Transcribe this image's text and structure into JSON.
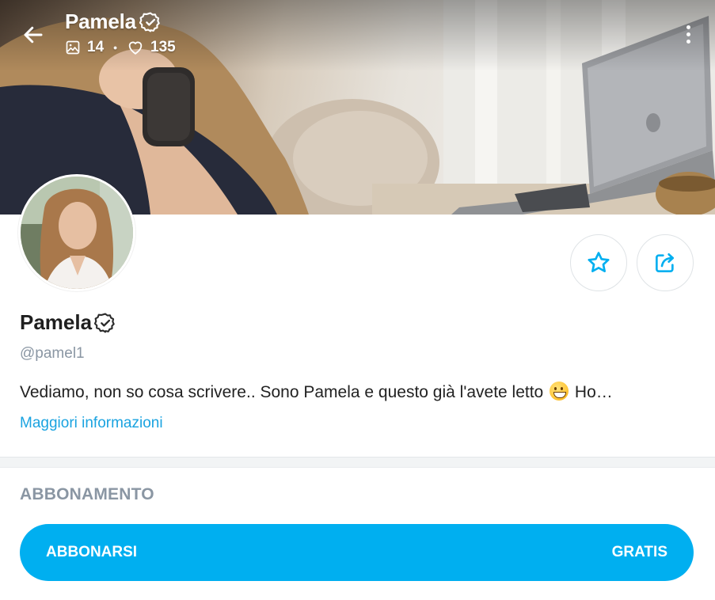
{
  "header": {
    "name": "Pamela",
    "media_count": "14",
    "likes_count": "135",
    "separator": "•"
  },
  "profile": {
    "name": "Pamela",
    "handle": "@pamel1",
    "bio": "Vediamo, non so cosa scrivere.. Sono Pamela e questo già l'avete letto",
    "bio_tail": "Ho…",
    "more_info": "Maggiori informazioni"
  },
  "subscription": {
    "section_title": "ABBONAMENTO",
    "button_label": "ABBONARSI",
    "price_label": "GRATIS"
  },
  "colors": {
    "accent": "#00aff0",
    "link": "#1aa3e0",
    "muted": "#8a96a3"
  },
  "icons": {
    "back": "arrow-left-icon",
    "verified": "verified-badge-icon",
    "media": "image-icon",
    "likes": "heart-icon",
    "more": "more-vertical-icon",
    "favorite": "star-icon",
    "share": "share-icon",
    "emoji": "grinning-face-emoji"
  }
}
